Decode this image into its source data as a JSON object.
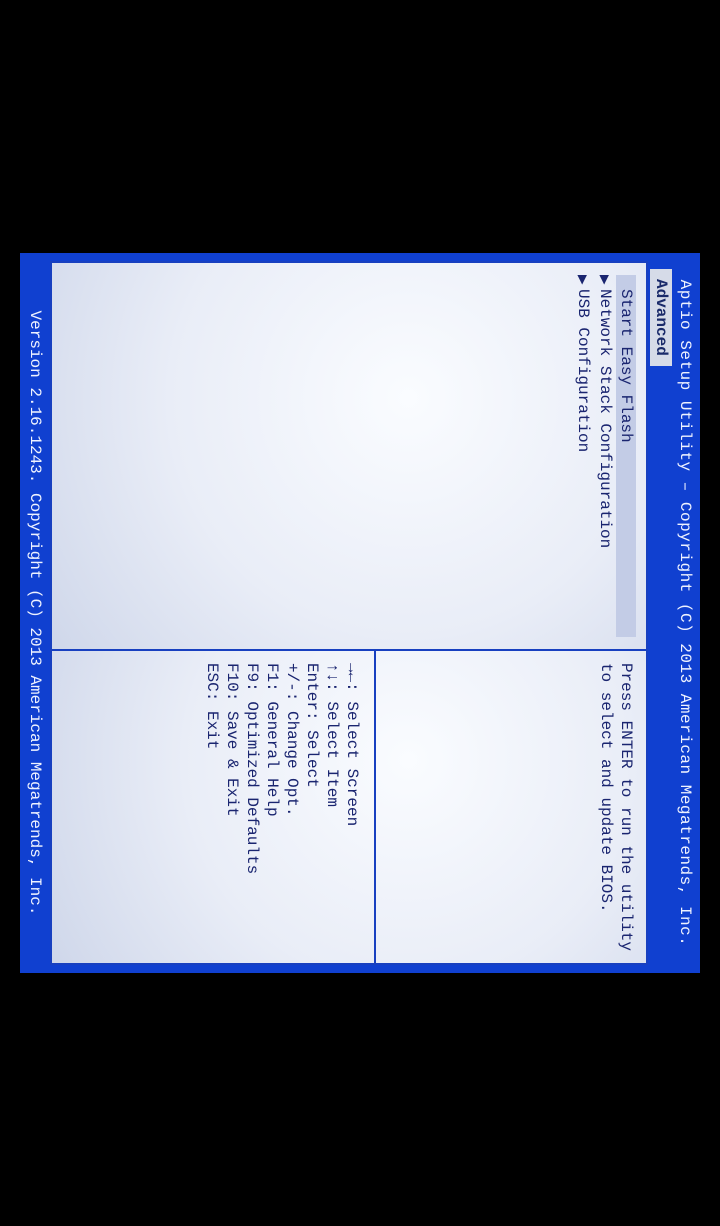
{
  "header": {
    "title": "Aptio Setup Utility – Copyright (C) 2013 American Megatrends, Inc."
  },
  "tabs": {
    "active": "Advanced"
  },
  "menu": {
    "items": [
      {
        "marker": " ",
        "label": "Start Easy Flash",
        "selected": true
      },
      {
        "marker": "▶",
        "label": "Network Stack Configuration",
        "selected": false
      },
      {
        "marker": "▶",
        "label": "USB Configuration",
        "selected": false
      }
    ]
  },
  "help": {
    "description_l1": "Press ENTER to run the utility",
    "description_l2": "to select and update BIOS.",
    "lines": [
      "→←: Select Screen",
      "↑↓: Select Item",
      "Enter: Select",
      "+/-: Change Opt.",
      "F1: General Help",
      "F9: Optimized Defaults",
      "F10: Save & Exit",
      "ESC: Exit"
    ]
  },
  "footer": {
    "version": "Version 2.16.1243. Copyright (C) 2013 American Megatrends, Inc."
  }
}
